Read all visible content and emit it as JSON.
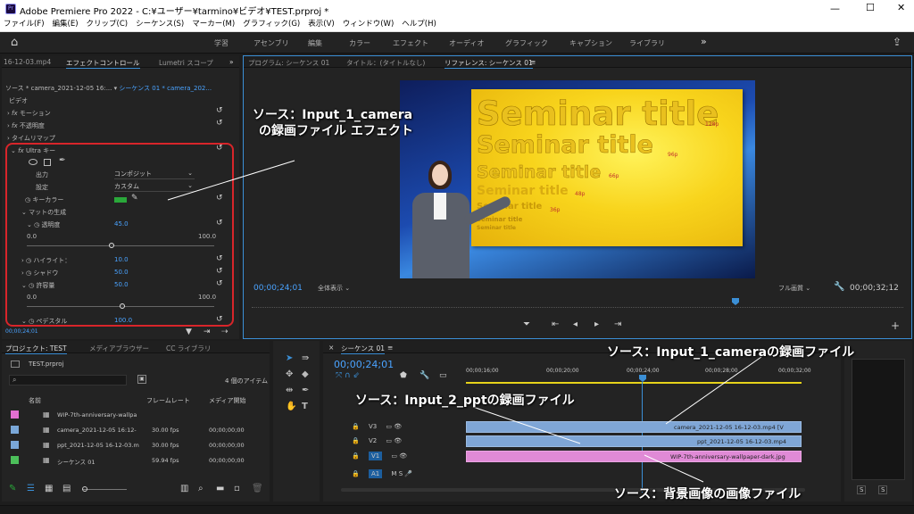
{
  "window": {
    "title": "Adobe Premiere Pro 2022 - C:¥ユーザー¥tarmino¥ビデオ¥TEST.prproj *",
    "icon": "Pr"
  },
  "menu": [
    "ファイル(F)",
    "編集(E)",
    "クリップ(C)",
    "シーケンス(S)",
    "マーカー(M)",
    "グラフィック(G)",
    "表示(V)",
    "ウィンドウ(W)",
    "ヘルプ(H)"
  ],
  "workspaces": [
    "学習",
    "アセンブリ",
    "編集",
    "カラー",
    "エフェクト",
    "オーディオ",
    "グラフィック",
    "キャプション",
    "ライブラリ"
  ],
  "effect_panel": {
    "tabs": [
      "16-12-03.mp4",
      "エフェクトコントロール",
      "Lumetri スコープ"
    ],
    "source": "ソース * camera_2021-12-05 16:...",
    "sequence": "シーケンス 01 * camera_202...",
    "section_video": "ビデオ",
    "fx": [
      "モーション",
      "不透明度",
      "タイムリマップ",
      "Ultra キー"
    ],
    "output_label": "出力",
    "output_value": "コンポジット",
    "setting_label": "設定",
    "setting_value": "カスタム",
    "keycolor_label": "キーカラー",
    "matte_gen": "マットの生成",
    "transparency_label": "透明度",
    "transparency_value": "45.0",
    "scale_min": "0.0",
    "scale_max": "100.0",
    "highlight_label": "ハイライト：",
    "highlight_value": "10.0",
    "shadow_label": "シャドウ",
    "shadow_value": "50.0",
    "tolerance_label": "許容量",
    "tolerance_value": "50.0",
    "pedestal_label": "ペデスタル",
    "pedestal_value": "100.0",
    "timecode": "00;00;24;01"
  },
  "monitor": {
    "tabs": [
      "プログラム: シーケンス 01",
      "タイトル：(タイトルなし)",
      "リファレンス: シーケンス 01"
    ],
    "timecode_left": "00;00;24;01",
    "fit": "全体表示",
    "quality": "フル画質",
    "timecode_right": "00;00;32;12",
    "slide_titles": [
      {
        "text": "Seminar title",
        "size": "128p"
      },
      {
        "text": "Seminar title",
        "size": "96p"
      },
      {
        "text": "Seminar title",
        "size": "66p"
      },
      {
        "text": "Seminar title",
        "size": "48p"
      },
      {
        "text": "Seminar title",
        "size": "36p"
      },
      {
        "text": "Seminar title",
        "size": ""
      },
      {
        "text": "Seminar title",
        "size": ""
      }
    ]
  },
  "project": {
    "tabs": [
      "プロジェクト: TEST",
      "メディアブラウザー",
      "CC ライブラリ"
    ],
    "file": "TEST.prproj",
    "count": "4 個のアイテム",
    "columns": [
      "名前",
      "フレームレート",
      "メディア開始"
    ],
    "items": [
      {
        "name": "WIP-7th-anniversary-wallpa",
        "fps": "",
        "start": "",
        "color": "#e26fd1"
      },
      {
        "name": "camera_2021-12-05 16:12-",
        "fps": "30.00 fps",
        "start": "00;00;00;00",
        "color": "#7aa7d8"
      },
      {
        "name": "ppt_2021-12-05 16-12-03.m",
        "fps": "30.00 fps",
        "start": "00;00;00;00",
        "color": "#7aa7d8"
      },
      {
        "name": "シーケンス 01",
        "fps": "59.94 fps",
        "start": "00;00;00;00",
        "color": "#4cbf5a"
      }
    ]
  },
  "timeline": {
    "tab": "シーケンス 01",
    "timecode": "00;00;24;01",
    "ruler": [
      "00;00;16;00",
      "00;00;20;00",
      "00;00;24;00",
      "00;00;28;00",
      "00;00;32;00"
    ],
    "tracks": [
      "V3",
      "V2",
      "V1",
      "A1"
    ],
    "clips": {
      "v3": "camera_2021-12-05 16-12-03.mp4 [V",
      "v2": "ppt_2021-12-05 16-12-03.mp4",
      "v1": "WIP-7th-anniversary-wallpaper-dark.jpg"
    },
    "audio_meter": [
      "S",
      "S"
    ]
  },
  "callouts": {
    "c1a": "ソース：Input_1_camera",
    "c1b": "の録画ファイル エフェクト",
    "c2": "ソース：Input_1_cameraの録画ファイル",
    "c3": "ソース：Input_2_pptの録画ファイル",
    "c4": "ソース：背景画像の画像ファイル"
  }
}
